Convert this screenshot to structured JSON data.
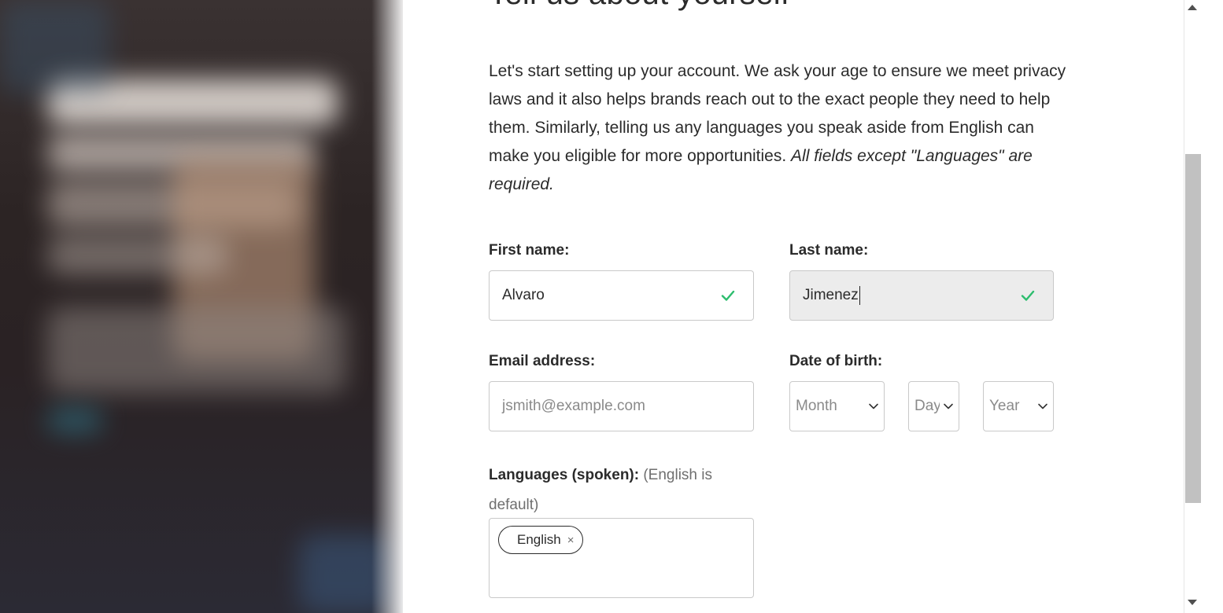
{
  "page": {
    "title": "Tell us about yourself",
    "intro": "Let's start setting up your account. We ask your age to ensure we meet privacy laws and it also helps brands reach out to the exact people they need to help them. Similarly, telling us any languages you speak aside from English can make you eligible for more opportunities.",
    "required_note": "All fields except \"Languages\" are required."
  },
  "form": {
    "first_name": {
      "label": "First name:",
      "value": "Alvaro",
      "status_icon": "check-icon"
    },
    "last_name": {
      "label": "Last name:",
      "value": "Jimenez",
      "status_icon": "check-icon"
    },
    "email": {
      "label": "Email address:",
      "placeholder": "jsmith@example.com"
    },
    "dob": {
      "label": "Date of birth:",
      "month": "Month",
      "day": "Day",
      "year": "Year"
    },
    "languages": {
      "label": "Languages (spoken):",
      "hint": "(English is default)",
      "tags": [
        "English"
      ],
      "remove_symbol": "×"
    }
  },
  "colors": {
    "check": "#2dbd6e",
    "border": "#c9c9c9",
    "text": "#2b2b2b",
    "placeholder": "#8a8a8a"
  }
}
